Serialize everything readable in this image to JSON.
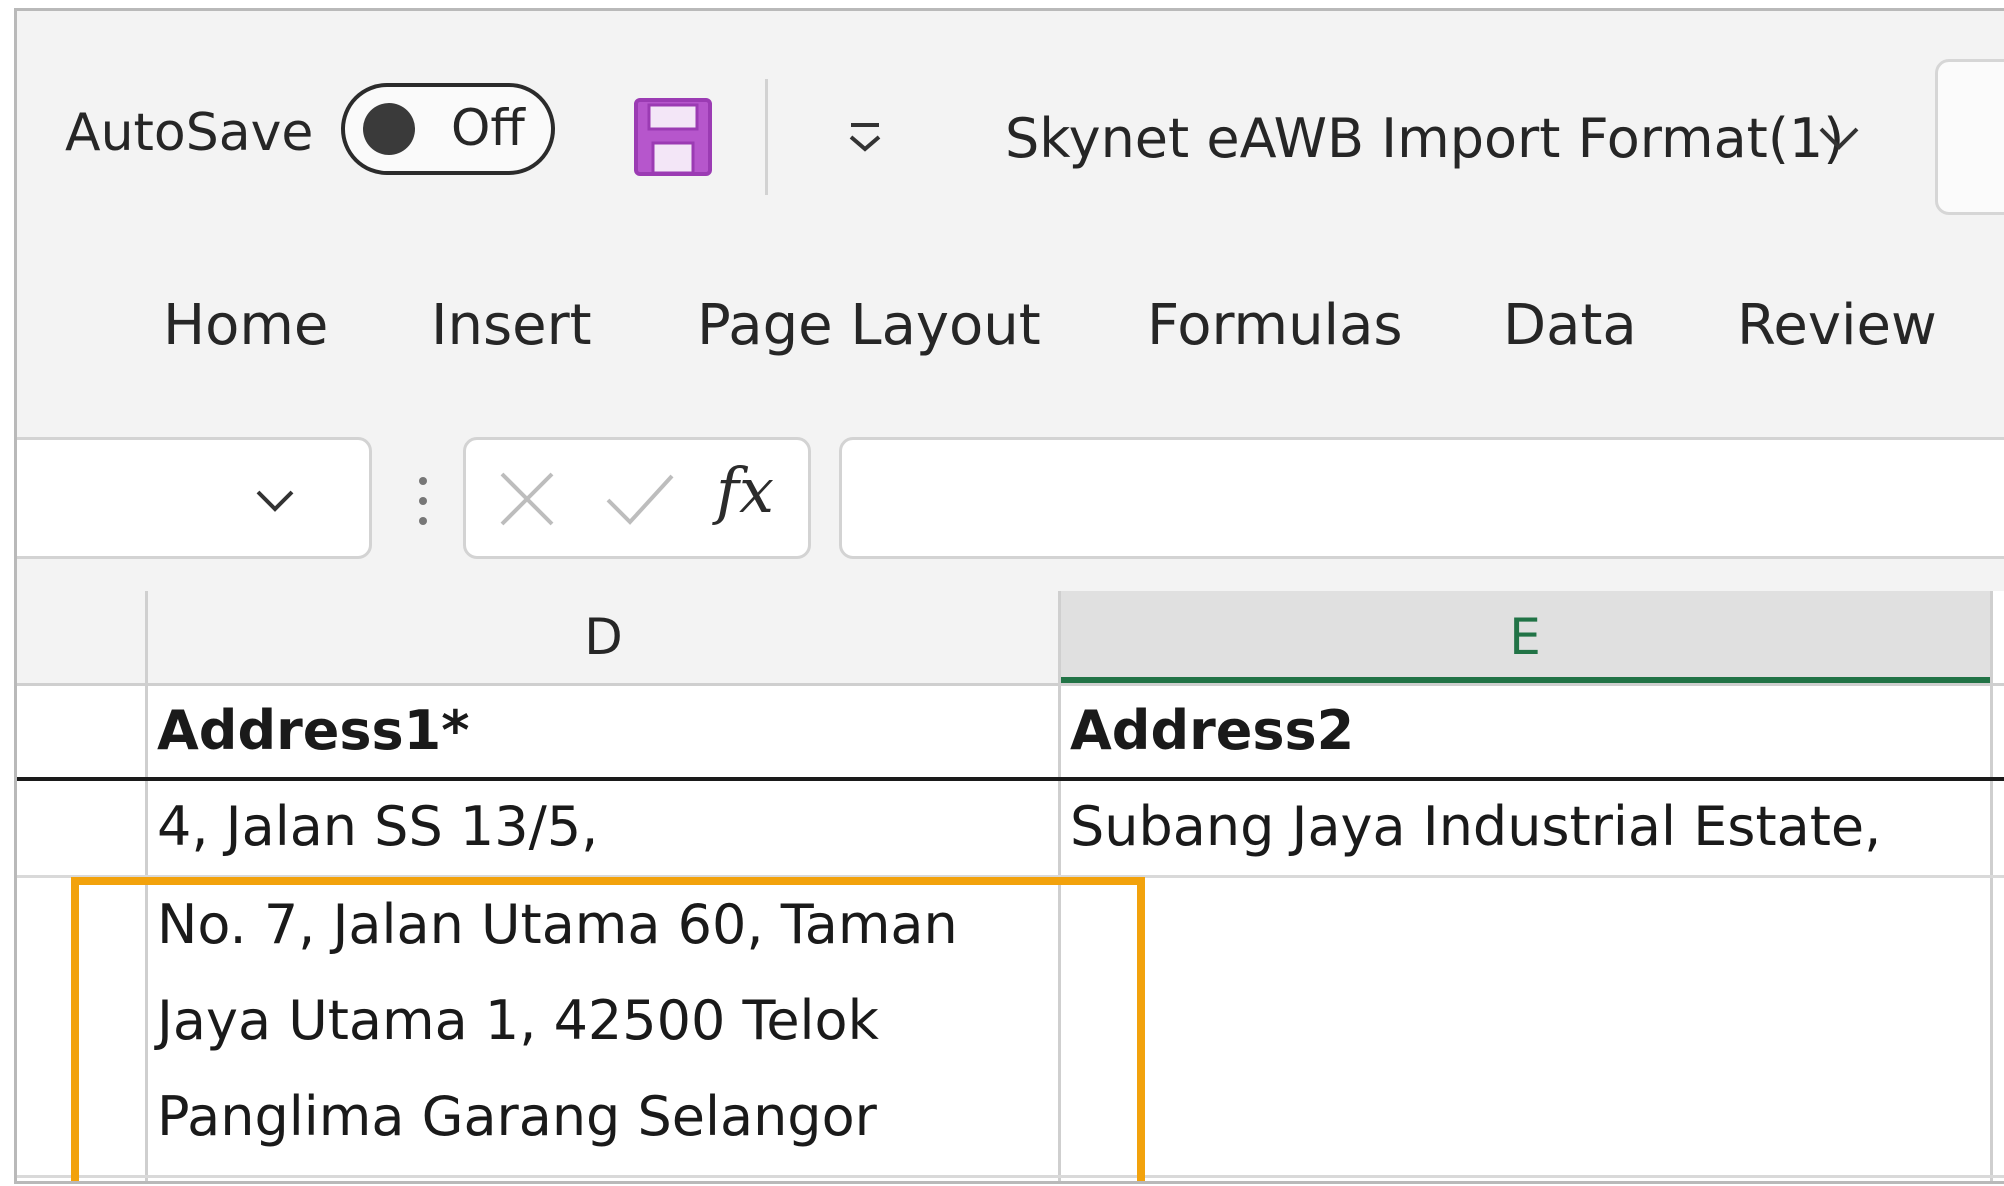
{
  "titlebar": {
    "autosave_label": "AutoSave",
    "autosave_state": "Off",
    "document_title": "Skynet eAWB Import Format(1)"
  },
  "ribbon": {
    "tabs": [
      "Home",
      "Insert",
      "Page Layout",
      "Formulas",
      "Data",
      "Review"
    ]
  },
  "formula_bar": {
    "name_box_value": "",
    "fx_label": "fx",
    "formula_value": ""
  },
  "sheet": {
    "columns": [
      "D",
      "E"
    ],
    "selected_column": "E",
    "header_row": {
      "D": "Address1*",
      "E": "Address2"
    },
    "rows": [
      {
        "D": "4, Jalan SS 13/5,",
        "E": "Subang Jaya Industrial Estate,"
      },
      {
        "D": "No. 7, Jalan Utama 60, Taman\nJaya Utama 1, 42500 Telok\nPanglima Garang Selangor",
        "E": ""
      }
    ]
  },
  "colors": {
    "accent_green": "#217346",
    "highlight_orange": "#f2a20c",
    "save_icon_purple": "#b656cc"
  },
  "icons": {
    "save": "floppy-disk-icon",
    "quick_access": "customize-quick-access-icon",
    "title_chevron": "chevron-down-icon",
    "namebox_chevron": "chevron-down-icon",
    "cancel": "cancel-x-icon",
    "enter": "checkmark-icon"
  }
}
